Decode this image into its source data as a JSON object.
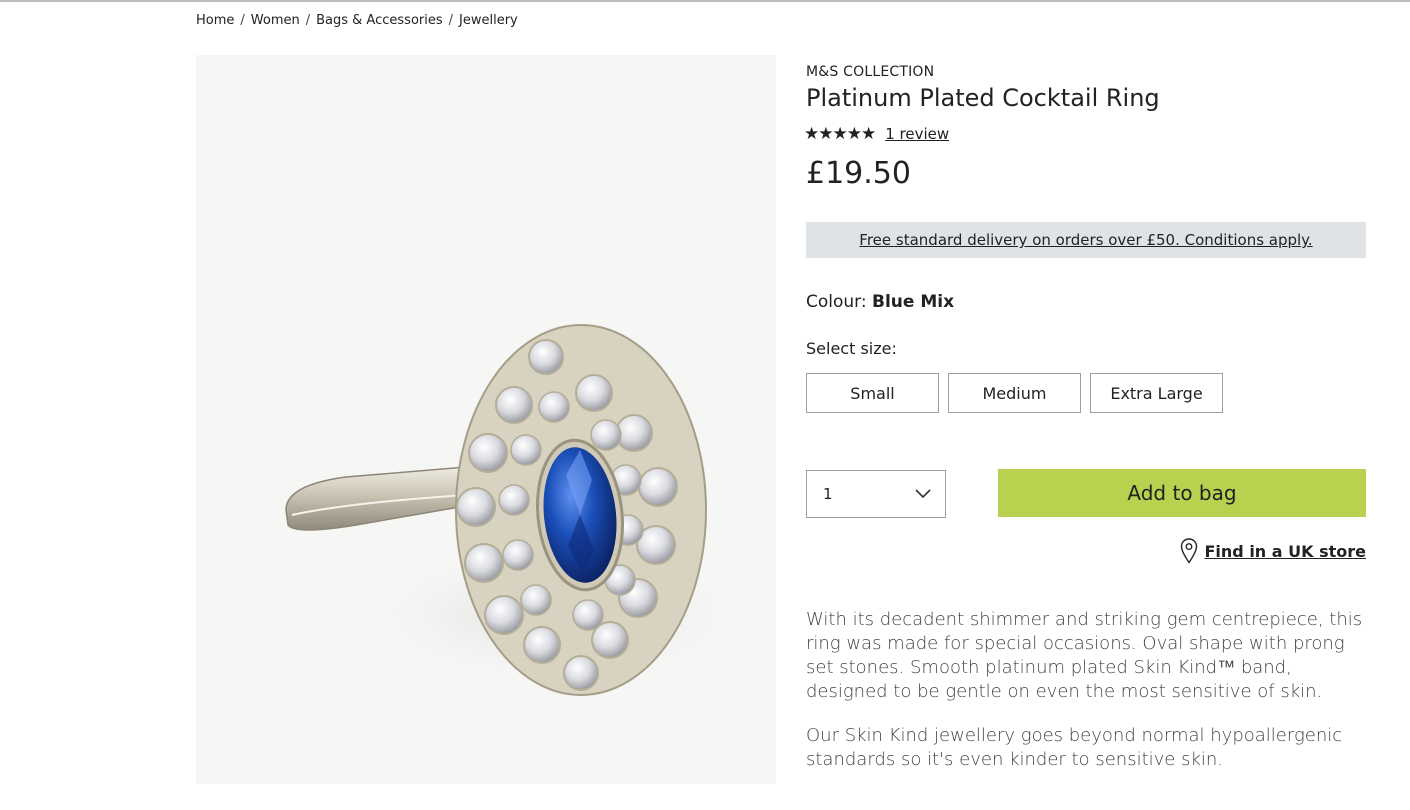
{
  "breadcrumb": {
    "items": [
      "Home",
      "Women",
      "Bags & Accessories",
      "Jewellery"
    ],
    "separator": "/"
  },
  "product": {
    "brand": "M&S COLLECTION",
    "title": "Platinum Plated Cocktail Ring",
    "stars": "★★★★★",
    "rating_value": 5,
    "review_link": "1 review",
    "price": "£19.50",
    "delivery_text": "Free standard delivery on orders over £50. Conditions apply.",
    "colour_label": "Colour:",
    "colour_value": "Blue Mix",
    "select_size_label": "Select size:",
    "sizes": [
      "Small",
      "Medium",
      "Extra Large"
    ],
    "quantity": "1",
    "add_to_bag": "Add to bag",
    "find_store": "Find in a UK store",
    "description_1": "With its decadent shimmer and striking gem centrepiece, this ring was made for special occasions. Oval shape with prong set stones. Smooth platinum plated Skin Kind™ band, designed to be gentle on even the most sensitive of skin.",
    "description_2": "Our Skin Kind jewellery goes beyond normal hypoallergenic standards so it's even kinder to sensitive skin."
  },
  "colors": {
    "add_to_bag_bg": "#b8d24f",
    "delivery_bg": "#e0e3e6",
    "gem_blue": "#1a4fb8"
  },
  "icons": {
    "location": "location-pin-icon",
    "chevron": "chevron-down-icon"
  }
}
